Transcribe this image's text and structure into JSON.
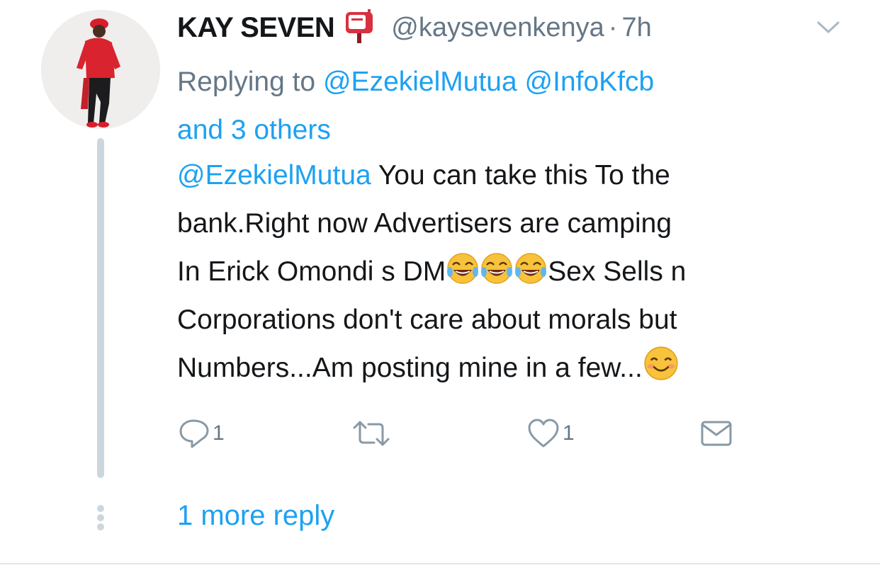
{
  "tweet": {
    "author_name": "KAY SEVEN",
    "author_badge_icon": "mailbox-icon",
    "handle": "@kaysevenkenya",
    "separator": "·",
    "time": "7h",
    "replying_prefix": "Replying to",
    "replying_to": [
      "@EzekielMutua",
      "@InfoKfcb"
    ],
    "replying_others": "and 3 others",
    "body": {
      "mention": "@EzekielMutua",
      "line1_rest": " You can take this To the",
      "line2": "bank.Right now Advertisers are camping",
      "line3_start": "In Erick Omondi s DM",
      "emoji_laughing": [
        "face-with-tears-of-joy",
        "face-with-tears-of-joy",
        "face-with-tears-of-joy"
      ],
      "line3_end": "Sex Sells n",
      "line4": "Corporations don't care about morals but",
      "line5": "Numbers...Am posting mine in a few...",
      "emoji_smile": "smiling-face-with-smiling-eyes"
    },
    "actions": {
      "reply_count": "1",
      "retweet_count": "",
      "like_count": "1"
    },
    "more_replies": "1 more reply"
  },
  "colors": {
    "link": "#1da1f2",
    "secondary_text": "#657786",
    "primary_text": "#14171a",
    "thread_line": "#ccd6dd"
  }
}
